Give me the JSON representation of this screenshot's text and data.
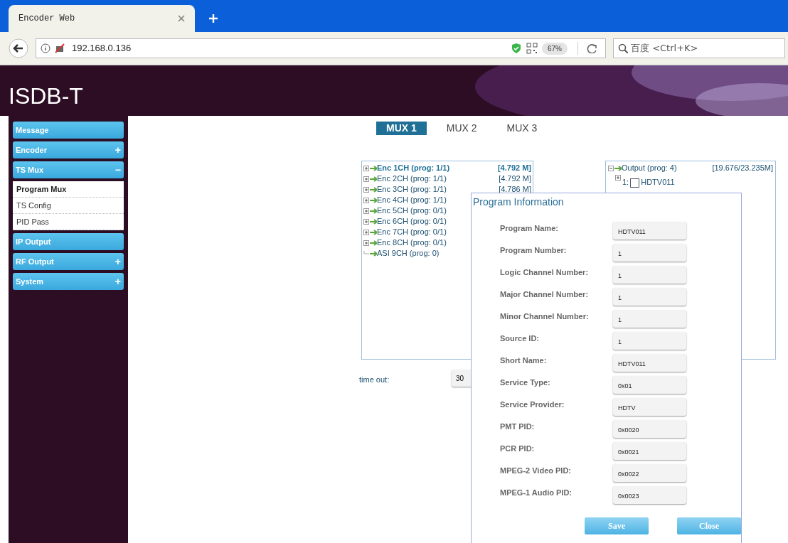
{
  "browser": {
    "tab_title": "Encoder Web",
    "address": "192.168.0.136",
    "zoom": "67%",
    "search_placeholder": "百度 <Ctrl+K>"
  },
  "header": {
    "title": "ISDB-T"
  },
  "sidebar": {
    "items": [
      {
        "label": "Message"
      },
      {
        "label": "Encoder",
        "toggle": "+"
      },
      {
        "label": "TS Mux",
        "toggle": "−",
        "children": [
          {
            "label": "Program Mux",
            "selected": true
          },
          {
            "label": "TS Config",
            "selected": false
          },
          {
            "label": "PID Pass",
            "selected": false
          }
        ]
      },
      {
        "label": "IP Output"
      },
      {
        "label": "RF Output",
        "toggle": "+"
      },
      {
        "label": "System",
        "toggle": "+"
      }
    ]
  },
  "mux_tabs": [
    {
      "label": "MUX 1",
      "selected": true
    },
    {
      "label": "MUX 2",
      "selected": false
    },
    {
      "label": "MUX 3",
      "selected": false
    }
  ],
  "input_tree": [
    {
      "label": "Enc 1CH (prog: 1/1)",
      "rate": "[4.792 M]",
      "kind": "group",
      "selected": true
    },
    {
      "label": "Enc 2CH (prog: 1/1)",
      "rate": "[4.792 M]",
      "kind": "group",
      "selected": false
    },
    {
      "label": "Enc 3CH (prog: 1/1)",
      "rate": "[4.786 M]",
      "kind": "group",
      "selected": false
    },
    {
      "label": "Enc 4CH (prog: 1/1)",
      "kind": "group",
      "selected": false
    },
    {
      "label": "Enc 5CH (prog: 0/1)",
      "kind": "group",
      "selected": false
    },
    {
      "label": "Enc 6CH (prog: 0/1)",
      "kind": "group",
      "selected": false
    },
    {
      "label": "Enc 7CH (prog: 0/1)",
      "kind": "group",
      "selected": false
    },
    {
      "label": "Enc 8CH (prog: 0/1)",
      "kind": "group",
      "selected": false
    },
    {
      "label": "ASI 9CH (prog: 0)",
      "kind": "leaf",
      "selected": false
    }
  ],
  "output_tree": {
    "label": "Output (prog: 4)",
    "rate": "[19.676/23.235M]",
    "expanded": true,
    "children": [
      {
        "index": "1:",
        "label": "HDTV011",
        "checked": false
      }
    ]
  },
  "timeout": {
    "label": "time out:",
    "value": "30"
  },
  "dialog": {
    "title": "Program Information",
    "fields": [
      {
        "label": "Program Name:",
        "value": "HDTV011"
      },
      {
        "label": "Program Number:",
        "value": "1"
      },
      {
        "label": "Logic Channel Number:",
        "value": "1"
      },
      {
        "label": "Major Channel Number:",
        "value": "1"
      },
      {
        "label": "Minor Channel Number:",
        "value": "1"
      },
      {
        "label": "Source ID:",
        "value": "1"
      },
      {
        "label": "Short Name:",
        "value": "HDTV011"
      },
      {
        "label": "Service Type:",
        "value": "0x01"
      },
      {
        "label": "Service Provider:",
        "value": "HDTV"
      },
      {
        "label": "PMT PID:",
        "value": "0x0020"
      },
      {
        "label": "PCR PID:",
        "value": "0x0021"
      },
      {
        "label": "MPEG-2 Video PID:",
        "value": "0x0022"
      },
      {
        "label": "MPEG-1 Audio PID:",
        "value": "0x0023"
      }
    ],
    "buttons": [
      "Save",
      "Close"
    ]
  }
}
